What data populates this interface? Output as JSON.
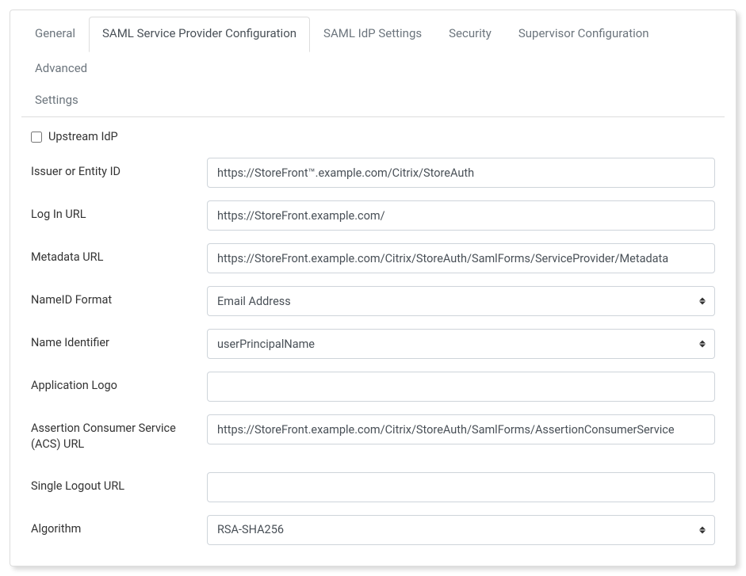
{
  "tabs": {
    "general": "General",
    "saml_sp": "SAML Service Provider Configuration",
    "saml_idp": "SAML IdP Settings",
    "security": "Security",
    "supervisor": "Supervisor Configuration",
    "advanced": "Advanced",
    "settings": "Settings"
  },
  "form": {
    "upstream_idp_label": "Upstream IdP",
    "issuer_label": "Issuer or Entity ID",
    "issuer_value": "https://StoreFront™.example.com/Citrix/StoreAuth",
    "login_url_label": "Log In URL",
    "login_url_value": "https://StoreFront.example.com/",
    "metadata_url_label": "Metadata URL",
    "metadata_url_value": "https://StoreFront.example.com/Citrix/StoreAuth/SamlForms/ServiceProvider/Metadata",
    "nameid_format_label": "NameID Format",
    "nameid_format_value": "Email Address",
    "name_identifier_label": "Name Identifier",
    "name_identifier_value": "userPrincipalName",
    "app_logo_label": "Application Logo",
    "app_logo_value": "",
    "acs_url_label": "Assertion Consumer Service (ACS) URL",
    "acs_url_value": "https://StoreFront.example.com/Citrix/StoreAuth/SamlForms/AssertionConsumerService",
    "slo_url_label": "Single Logout URL",
    "slo_url_value": "",
    "algorithm_label": "Algorithm",
    "algorithm_value": "RSA-SHA256"
  }
}
